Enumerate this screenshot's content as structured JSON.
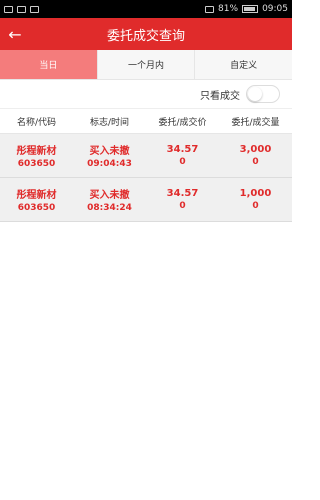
{
  "status_bar": {
    "battery": "81%",
    "time": "09:05"
  },
  "header": {
    "title": "委托成交查询",
    "back_icon": "arrow-left-icon"
  },
  "tabs": [
    {
      "label": "当日",
      "active": true
    },
    {
      "label": "一个月内",
      "active": false
    },
    {
      "label": "自定义",
      "active": false
    }
  ],
  "filter": {
    "label": "只看成交",
    "enabled": false
  },
  "columns": [
    "名称/代码",
    "标志/时间",
    "委托/成交价",
    "委托/成交量"
  ],
  "rows": [
    {
      "name": "彤程新材",
      "code": "603650",
      "flag": "买入未撤",
      "time": "09:04:43",
      "order_price": "34.57",
      "deal_price": "0",
      "order_qty": "3,000",
      "deal_qty": "0"
    },
    {
      "name": "彤程新材",
      "code": "603650",
      "flag": "买入未撤",
      "time": "08:34:24",
      "order_price": "34.57",
      "deal_price": "0",
      "order_qty": "1,000",
      "deal_qty": "0"
    }
  ],
  "colors": {
    "brand_red": "#e02b2b",
    "active_tab": "#f47c7c"
  }
}
